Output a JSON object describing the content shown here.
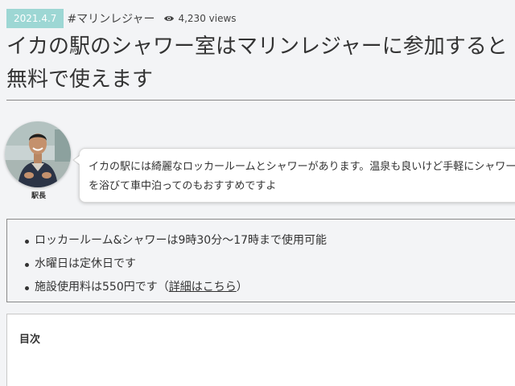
{
  "meta": {
    "date": "2021.4.7",
    "tag": "#マリンレジャー",
    "views": "4,230 views",
    "views_icon": "eye-icon"
  },
  "article": {
    "title": "イカの駅のシャワー室はマリンレジャーに参加すると無料で使えます"
  },
  "speech": {
    "avatar_name": "駅長",
    "text": "イカの駅には綺麗なロッカールームとシャワーがあります。温泉も良いけど手軽にシャワーを浴びて車中泊ってのもおすすめですよ"
  },
  "info": {
    "items": [
      "ロッカールーム&シャワーは9時30分～17時まで使用可能",
      "水曜日は定休日です"
    ],
    "fee_prefix": "施設使用料は550円です（",
    "fee_link": "詳細はこちら",
    "fee_suffix": "）"
  },
  "toc": {
    "title": "目次"
  },
  "colors": {
    "date_badge": "#9dd7d4",
    "background": "#f3f4f6"
  }
}
